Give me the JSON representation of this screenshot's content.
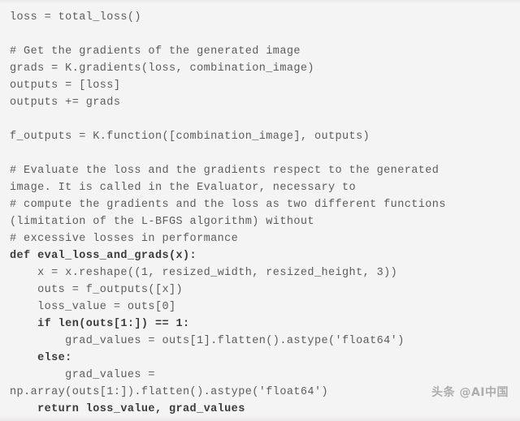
{
  "editor": {
    "language": "python",
    "background_color": "#f4f4f4",
    "text_color": "#5c5c5c",
    "keyword_color": "#3b3b3b",
    "lines": [
      {
        "text": "loss = total_loss()",
        "kind": "code"
      },
      {
        "text": "",
        "kind": "blank"
      },
      {
        "text": "# Get the gradients of the generated image",
        "kind": "comment"
      },
      {
        "text": "grads = K.gradients(loss, combination_image)",
        "kind": "code"
      },
      {
        "text": "outputs = [loss]",
        "kind": "code"
      },
      {
        "text": "outputs += grads",
        "kind": "code"
      },
      {
        "text": "",
        "kind": "blank"
      },
      {
        "text": "f_outputs = K.function([combination_image], outputs)",
        "kind": "code"
      },
      {
        "text": "",
        "kind": "blank"
      },
      {
        "text": "# Evaluate the loss and the gradients respect to the generated",
        "kind": "comment"
      },
      {
        "text": "image. It is called in the Evaluator, necessary to",
        "kind": "comment"
      },
      {
        "text": "# compute the gradients and the loss as two different functions",
        "kind": "comment"
      },
      {
        "text": "(limitation of the L-BFGS algorithm) without",
        "kind": "comment"
      },
      {
        "text": "# excessive losses in performance",
        "kind": "comment"
      },
      {
        "text": "def eval_loss_and_grads(x):",
        "kind": "keyword"
      },
      {
        "text": "    x = x.reshape((1, resized_width, resized_height, 3))",
        "kind": "code"
      },
      {
        "text": "    outs = f_outputs([x])",
        "kind": "code"
      },
      {
        "text": "    loss_value = outs[0]",
        "kind": "code"
      },
      {
        "text": "    if len(outs[1:]) == 1:",
        "kind": "keyword"
      },
      {
        "text": "        grad_values = outs[1].flatten().astype('float64')",
        "kind": "code"
      },
      {
        "text": "    else:",
        "kind": "keyword"
      },
      {
        "text": "        grad_values =",
        "kind": "code"
      },
      {
        "text": "np.array(outs[1:]).flatten().astype('float64')",
        "kind": "code"
      },
      {
        "text": "    return loss_value, grad_values",
        "kind": "keyword"
      }
    ]
  },
  "watermark": {
    "text": "头条 @AI中国"
  }
}
